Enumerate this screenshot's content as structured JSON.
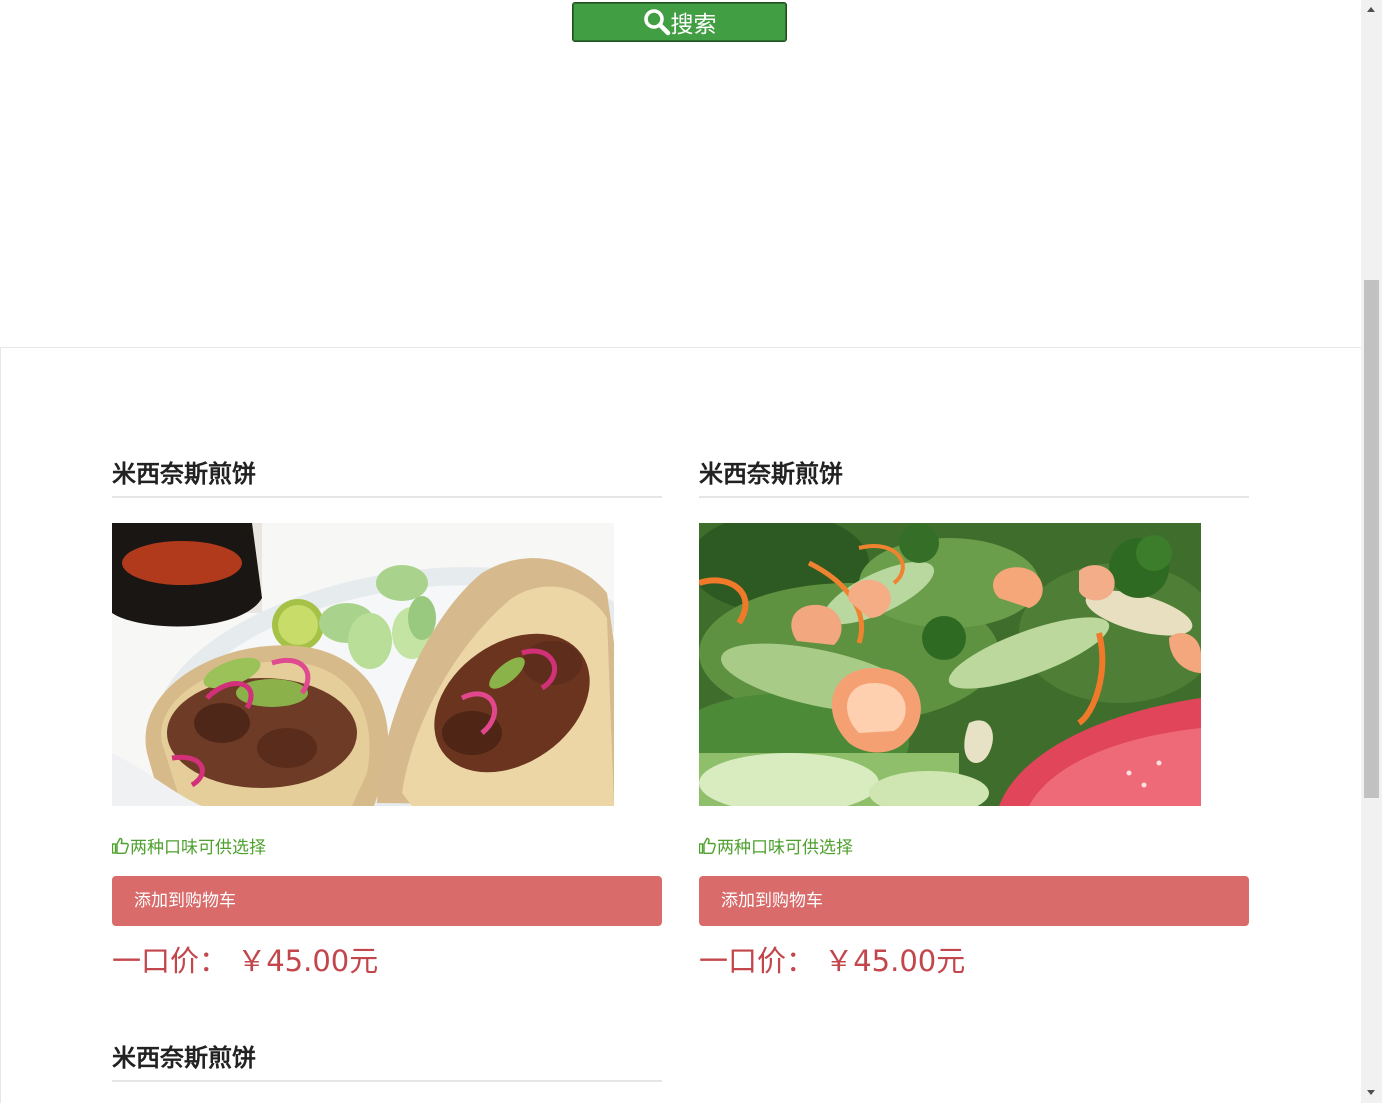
{
  "search": {
    "label": "搜索",
    "icon": "search-icon",
    "color": "#429e42"
  },
  "products": [
    {
      "title": "米西奈斯煎饼",
      "image": "tacos-photo",
      "feature": "两种口味可供选择",
      "cart_label": "添加到购物车",
      "price": "一口价： ￥45.00元"
    },
    {
      "title": "米西奈斯煎饼",
      "image": "shrimp-salad-photo",
      "feature": "两种口味可供选择",
      "cart_label": "添加到购物车",
      "price": "一口价： ￥45.00元"
    },
    {
      "title": "米西奈斯煎饼"
    }
  ],
  "colors": {
    "cart_button": "#d96b6a",
    "price": "#c2464b",
    "feature": "#4ea12e"
  }
}
